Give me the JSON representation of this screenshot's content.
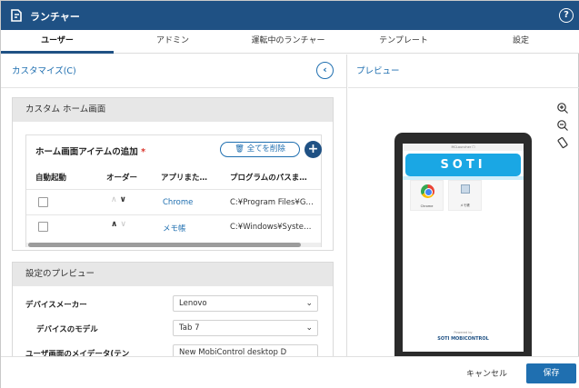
{
  "window": {
    "title": "ランチャー",
    "help_icon": "question-circle-icon",
    "app_icon": "launcher-icon"
  },
  "tabs": [
    {
      "label": "ユーザー",
      "active": true
    },
    {
      "label": "アドミン"
    },
    {
      "label": "運転中のランチャー"
    },
    {
      "label": "テンプレート"
    },
    {
      "label": "設定"
    }
  ],
  "left": {
    "customize_label": "カスタマイズ(C)",
    "collapse_icon": "chevron-left-icon",
    "custom_home": {
      "header": "カスタム ホーム画面",
      "section_title": "ホーム画面アイテムの追加",
      "required_mark": "*",
      "delete_all_label": "全てを削除",
      "add_label": "+",
      "columns": [
        "自動起動",
        "オーダー",
        "アプリまた…",
        "プログラムのパスま…"
      ],
      "rows": [
        {
          "autostart": false,
          "order": [
            "∧",
            "∨"
          ],
          "app": "Chrome",
          "path": "C:¥Program Files¥G…"
        },
        {
          "autostart": false,
          "order": [
            "∧",
            "∨"
          ],
          "app": "メモ帳",
          "path": "C:¥Windows¥Syste…"
        }
      ]
    },
    "settings_preview": {
      "header": "設定のプレビュー",
      "device_maker_label": "デバイスメーカー",
      "device_maker_value": "Lenovo",
      "device_model_label": "デバイスのモデル",
      "device_model_value": "Tab 7",
      "third_label": "ユーザ画面のメイデータ(テン",
      "third_value": "New MobiControl desktop D"
    }
  },
  "right": {
    "preview_label": "プレビュー",
    "tools": [
      "zoom-in-icon",
      "zoom-out-icon",
      "rotate-icon"
    ],
    "device_screen": {
      "status_text": "MCLauncher ☐",
      "banner": "SOTI",
      "apps": [
        {
          "label": "Chrome",
          "icon": "chrome-icon"
        },
        {
          "label": "メモ帳",
          "icon": "notepad-icon"
        }
      ],
      "powered_by": "Powered by",
      "logo_text": "SOTI MOBICONTROL"
    }
  },
  "footer": {
    "cancel_label": "キャンセル",
    "save_label": "保存"
  },
  "colors": {
    "titlebar": "#1f5184",
    "accent": "#1f6fb0",
    "soti_banner": "#1aa7e4"
  }
}
